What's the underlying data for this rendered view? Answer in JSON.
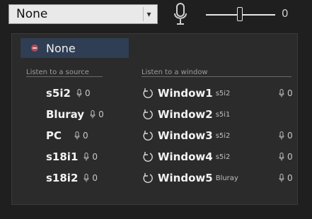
{
  "combo": {
    "value": "None",
    "arrow": "▾"
  },
  "volume": {
    "value": "0",
    "level": 0.5
  },
  "menu": {
    "none_label": "None",
    "sources_header": "Listen to a source",
    "windows_header": "Listen to a window",
    "sources": [
      {
        "name": "s5i2",
        "value": "0"
      },
      {
        "name": "Bluray",
        "value": "0"
      },
      {
        "name": "PC",
        "value": "0"
      },
      {
        "name": "s18i1",
        "value": "0"
      },
      {
        "name": "s18i2",
        "value": "0"
      }
    ],
    "windows": [
      {
        "name": "Window1",
        "sub": "s5i2",
        "value": "0"
      },
      {
        "name": "Window2",
        "sub": "s5i1",
        "value": ""
      },
      {
        "name": "Window3",
        "sub": "s5i2",
        "value": "0"
      },
      {
        "name": "Window4",
        "sub": "s5i2",
        "value": "0"
      },
      {
        "name": "Window5",
        "sub": "Bluray",
        "value": "0"
      }
    ]
  },
  "icons": {
    "mic": "microphone-icon",
    "window": "window-audio-icon",
    "none": "none-source-icon"
  },
  "colors": {
    "background": "#1f1f1f",
    "panel": "#2b2b2b",
    "highlight": "#2f3e52",
    "text": "#e6e6e6"
  }
}
